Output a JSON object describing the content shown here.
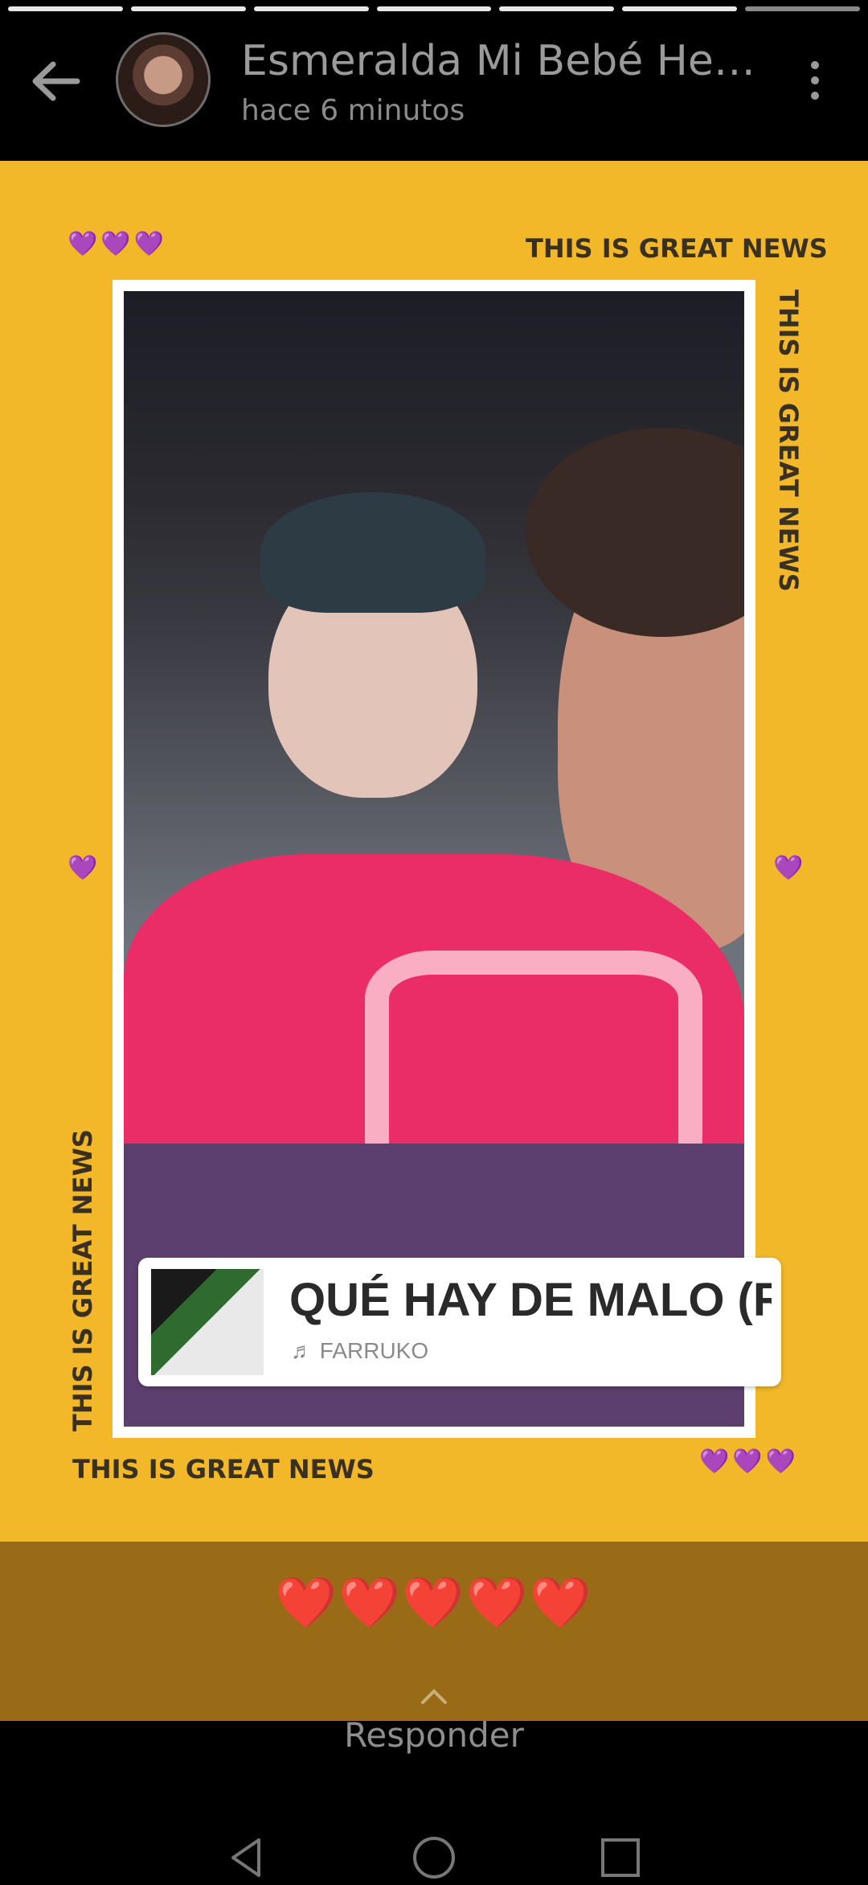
{
  "header": {
    "contact_name": "Esmeralda Mi Bebé He…",
    "timestamp": "hace 6 minutos"
  },
  "story": {
    "progress_segments": 7,
    "current_segment": 7,
    "caption": "THIS IS GREAT NEWS",
    "heart_emoji": "💜",
    "music": {
      "title": "QUÉ HAY DE MALO (REGG",
      "artist": "FARRUKO",
      "note_icon": "♬"
    }
  },
  "reply_bar": {
    "reactions": "❤️❤️❤️❤️❤️",
    "reply_label": "Responder"
  },
  "colors": {
    "story_background": "#f2b82a",
    "reply_bar": "#9a6b17",
    "heart_purple": "#8a2be2"
  }
}
